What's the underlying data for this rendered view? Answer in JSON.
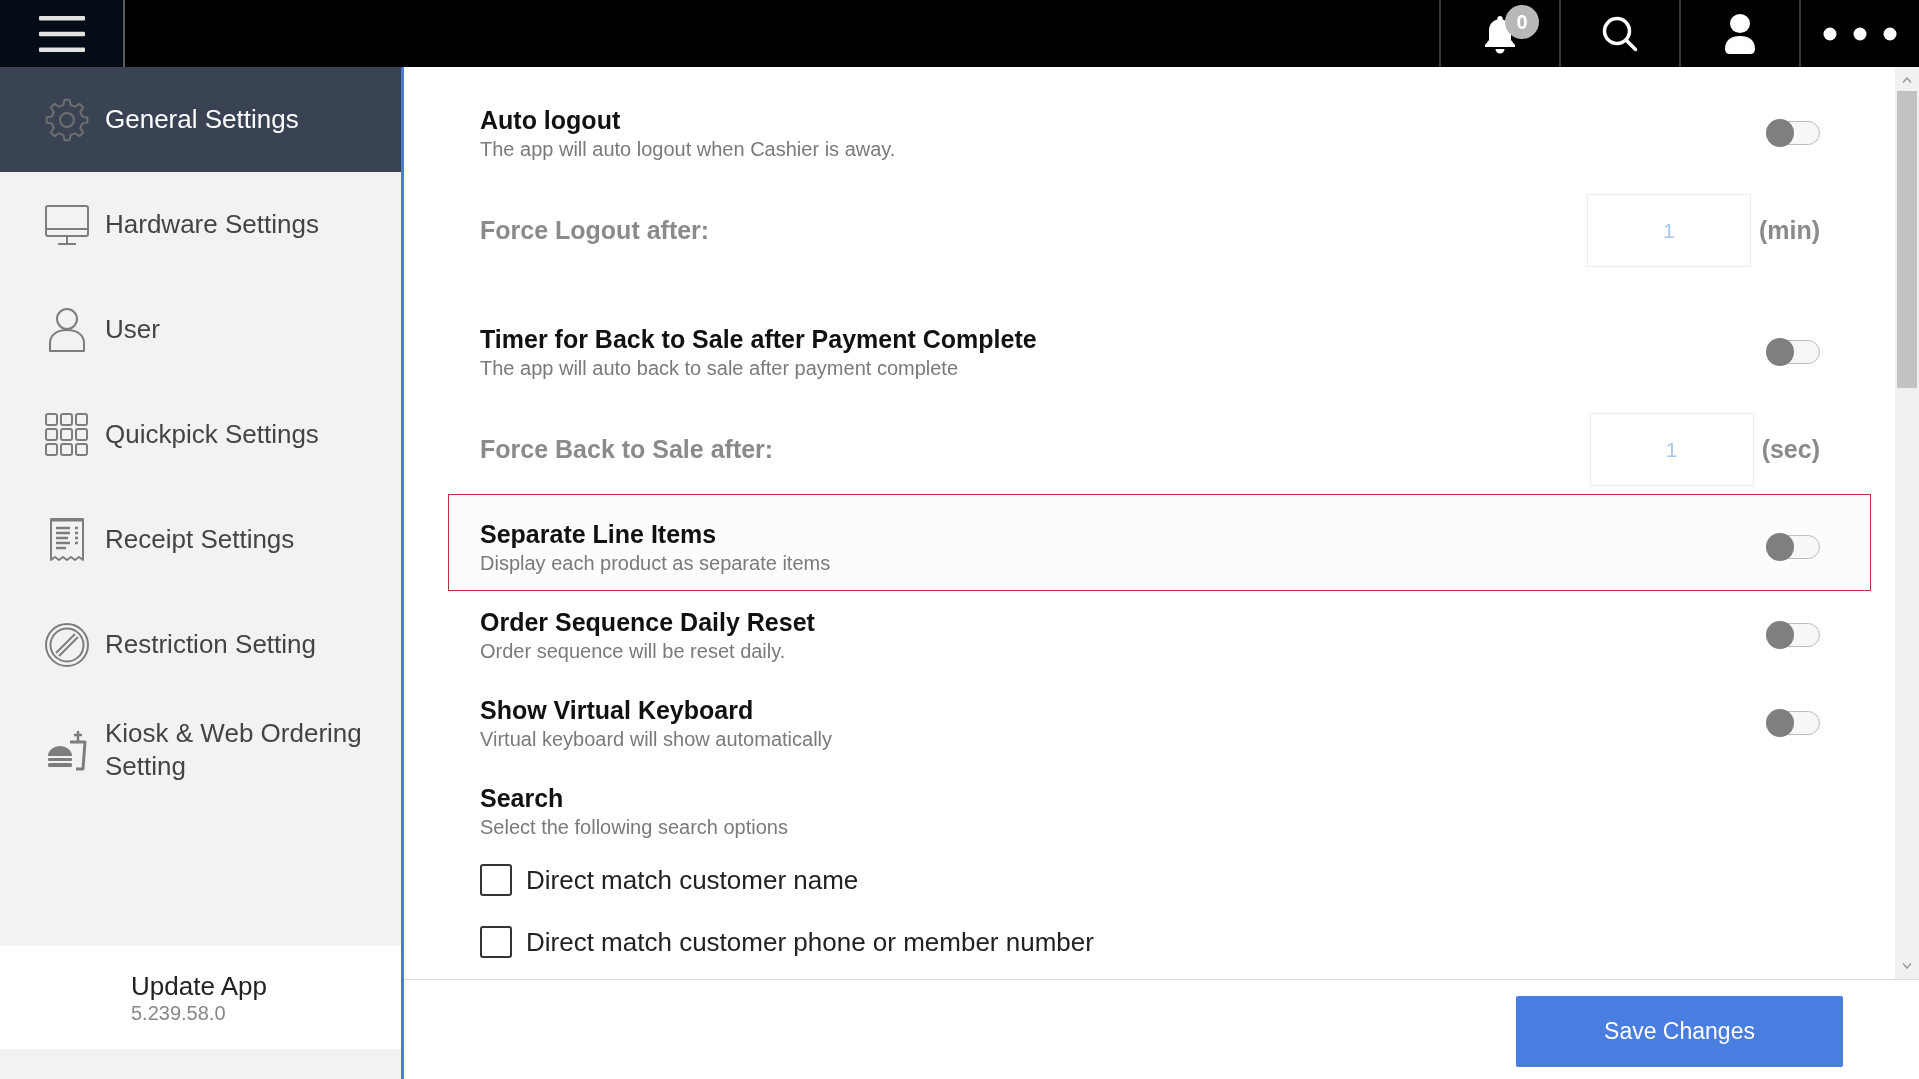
{
  "top_bar": {
    "actions": [
      {
        "kind": "notifications",
        "badge": "0"
      },
      {
        "kind": "search"
      },
      {
        "kind": "account"
      },
      {
        "kind": "more"
      }
    ]
  },
  "sidebar": {
    "items": [
      {
        "kind": "general",
        "label": "General Settings",
        "selected": true
      },
      {
        "kind": "hardware",
        "label": "Hardware Settings",
        "selected": false
      },
      {
        "kind": "user",
        "label": "User",
        "selected": false
      },
      {
        "kind": "quickpick",
        "label": "Quickpick Settings",
        "selected": false
      },
      {
        "kind": "receipt",
        "label": "Receipt Settings",
        "selected": false
      },
      {
        "kind": "restriction",
        "label": "Restriction Setting",
        "selected": false
      },
      {
        "kind": "kiosk",
        "label": "Kiosk & Web Ordering Setting",
        "selected": false
      }
    ],
    "update": {
      "title": "Update App",
      "version": "5.239.58.0"
    }
  },
  "settings": [
    {
      "kind": "toggle",
      "title": "Auto logout",
      "description": "The app will auto logout when Cashier is away.",
      "on": false,
      "highlighted": false
    },
    {
      "kind": "duration",
      "label": "Force Logout after:",
      "value": "1",
      "unit": "(min)",
      "disabled": true
    },
    {
      "kind": "toggle",
      "title": "Timer for Back to Sale after Payment Complete",
      "description": "The app will auto back to sale after payment complete",
      "on": false,
      "highlighted": false
    },
    {
      "kind": "duration",
      "label": "Force Back to Sale after:",
      "value": "1",
      "unit": "(sec)",
      "disabled": true
    },
    {
      "kind": "toggle",
      "title": "Separate Line Items",
      "description": "Display each product as separate items",
      "on": false,
      "highlighted": true
    },
    {
      "kind": "toggle",
      "title": "Order Sequence Daily Reset",
      "description": "Order sequence will be reset daily.",
      "on": false,
      "highlighted": false
    },
    {
      "kind": "toggle",
      "title": "Show Virtual Keyboard",
      "description": "Virtual keyboard will show automatically",
      "on": false,
      "highlighted": false
    },
    {
      "kind": "section",
      "title": "Search",
      "description": "Select the following search options"
    },
    {
      "kind": "checkbox",
      "label": "Direct match customer name",
      "checked": false
    },
    {
      "kind": "checkbox",
      "label": "Direct match customer phone or member number",
      "checked": false
    }
  ],
  "footer": {
    "save_button": "Save Changes"
  }
}
